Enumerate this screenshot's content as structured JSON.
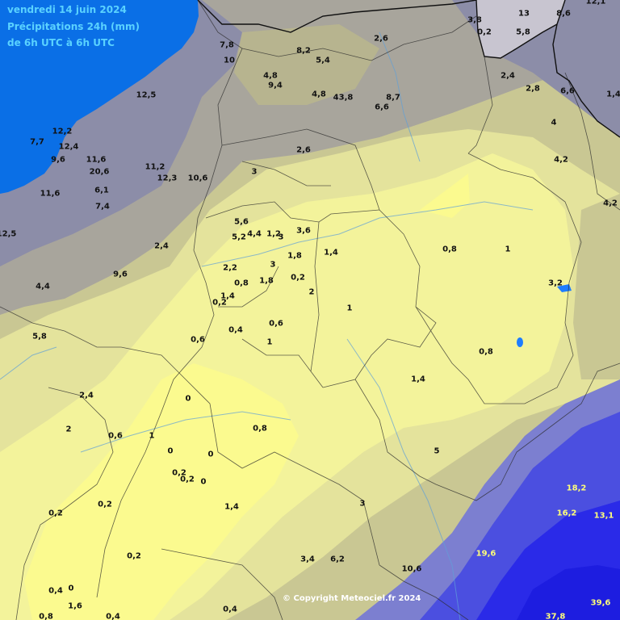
{
  "header": {
    "date": "vendredi 14 juin 2024",
    "title": "Précipitations 24h (mm)",
    "period": "de 6h UTC à 6h UTC"
  },
  "copyright": "© Copyright Meteociel.fr 2024",
  "palette": {
    "sea": "#0a6fe6",
    "grey_dark": "#8c8da8",
    "grey": "#a8a59c",
    "olive": "#c9c793",
    "pale_yellow": "#e4e39c",
    "yellow": "#f3f39b",
    "bright_yellow": "#fbfa8f",
    "blue_light": "#5f65d6",
    "blue": "#3b3fe0",
    "blue_deep": "#2424e6",
    "label_dark": "#111111",
    "label_light": "#ffff7a"
  },
  "values": [
    {
      "t": "3,8"
    },
    {
      "t": "13"
    },
    {
      "t": "8,6"
    },
    {
      "t": "0,2"
    },
    {
      "t": "5,8"
    },
    {
      "t": "7,8"
    },
    {
      "t": "8,2"
    },
    {
      "t": "2,6"
    },
    {
      "t": "10"
    },
    {
      "t": "5,4"
    },
    {
      "t": "4,8"
    },
    {
      "t": "9,4"
    },
    {
      "t": "2,4"
    },
    {
      "t": "2,8"
    },
    {
      "t": "6,6"
    },
    {
      "t": "12,5"
    },
    {
      "t": "4,8"
    },
    {
      "t": "43,8"
    },
    {
      "t": "8,7"
    },
    {
      "t": "6,6"
    },
    {
      "t": "1,4"
    },
    {
      "t": "12,2"
    },
    {
      "t": "4"
    },
    {
      "t": "7,7"
    },
    {
      "t": "12,4"
    },
    {
      "t": "2,6"
    },
    {
      "t": "9,6"
    },
    {
      "t": "11,6"
    },
    {
      "t": "4,2"
    },
    {
      "t": "20,6"
    },
    {
      "t": "11,2"
    },
    {
      "t": "3"
    },
    {
      "t": "12,3"
    },
    {
      "t": "10,6"
    },
    {
      "t": "6,1"
    },
    {
      "t": "11,6"
    },
    {
      "t": "4,2"
    },
    {
      "t": "7,4"
    },
    {
      "t": "5,6"
    },
    {
      "t": "3,6"
    },
    {
      "t": "12,5"
    },
    {
      "t": "5,2"
    },
    {
      "t": "4,4"
    },
    {
      "t": "1,2"
    },
    {
      "t": "3"
    },
    {
      "t": "2,4"
    },
    {
      "t": "0,8"
    },
    {
      "t": "1"
    },
    {
      "t": "1,8"
    },
    {
      "t": "1,4"
    },
    {
      "t": "2,2"
    },
    {
      "t": "3"
    },
    {
      "t": "9,6"
    },
    {
      "t": "0,2"
    },
    {
      "t": "0,8"
    },
    {
      "t": "1,8"
    },
    {
      "t": "3,2"
    },
    {
      "t": "4,4"
    },
    {
      "t": "2"
    },
    {
      "t": "1,4"
    },
    {
      "t": "0,2"
    },
    {
      "t": "1"
    },
    {
      "t": "0,6"
    },
    {
      "t": "0,4"
    },
    {
      "t": "5,8"
    },
    {
      "t": "0,6"
    },
    {
      "t": "0,8"
    },
    {
      "t": "1"
    },
    {
      "t": "1,4"
    },
    {
      "t": "2,4"
    },
    {
      "t": "0"
    },
    {
      "t": "2"
    },
    {
      "t": "0,8"
    },
    {
      "t": "0,6"
    },
    {
      "t": "1"
    },
    {
      "t": "0"
    },
    {
      "t": "0"
    },
    {
      "t": "5"
    },
    {
      "t": "0,2"
    },
    {
      "t": "0,2"
    },
    {
      "t": "0"
    },
    {
      "t": "18,2"
    },
    {
      "t": "0,2"
    },
    {
      "t": "3"
    },
    {
      "t": "1,4"
    },
    {
      "t": "16,2"
    },
    {
      "t": "13,1"
    },
    {
      "t": "0,2"
    },
    {
      "t": "19,6"
    },
    {
      "t": "0,2"
    },
    {
      "t": "3,4"
    },
    {
      "t": "6,2"
    },
    {
      "t": "10,6"
    },
    {
      "t": "0,4"
    },
    {
      "t": "0"
    },
    {
      "t": "39,6"
    },
    {
      "t": "1,6"
    },
    {
      "t": "0,4"
    },
    {
      "t": "0,8"
    },
    {
      "t": "0,4"
    },
    {
      "t": "37,8"
    },
    {
      "t": "12,1"
    }
  ]
}
